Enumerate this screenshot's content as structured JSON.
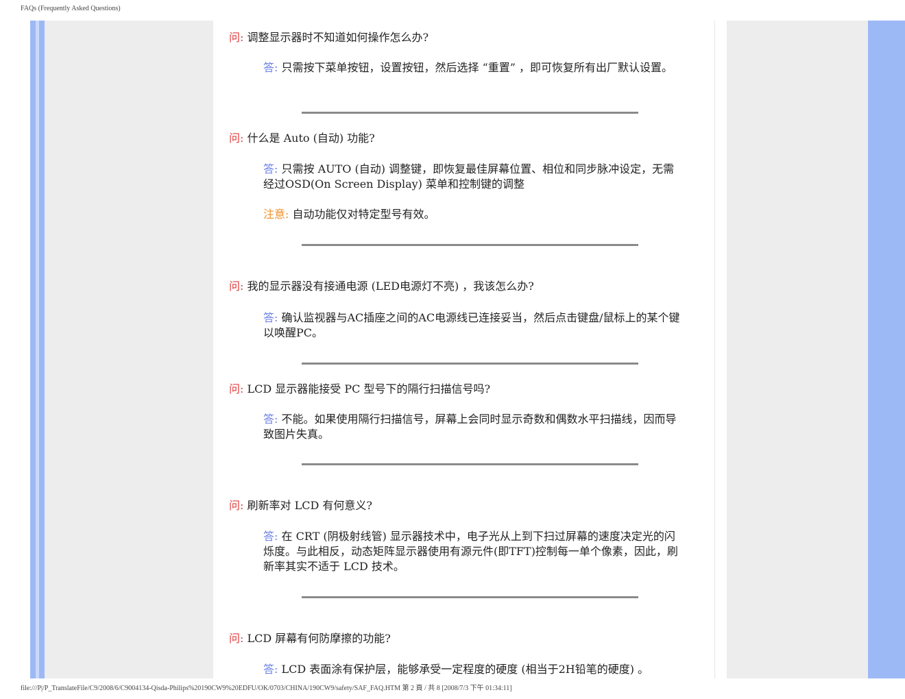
{
  "page": {
    "header_title": "FAQs (Frequently Asked Questions)",
    "footer_text": "file:///P|/P_TranslateFile/C9/2008/6/C9004134-Qisda-Philips%20190CW9%20EDFU/OK/0703/CHINA/190CW9/safety/SAF_FAQ.HTM 第 2 頁 / 共 8  [2008/7/3 下午 01:34:11]"
  },
  "labels": {
    "question": "问:",
    "answer": "答:",
    "note": "注意:"
  },
  "faqs": [
    {
      "question": "调整显示器时不知道如何操作怎么办?",
      "answer": "只需按下菜单按钮，设置按钮，然后选择 “重置” ，即可恢复所有出厂默认设置。"
    },
    {
      "question": "什么是 Auto (自动) 功能?",
      "answer": "只需按 AUTO (自动) 调整键，即恢复最佳屏幕位置、相位和同步脉冲设定，无需经过OSD(On Screen Display) 菜单和控制键的调整",
      "note": "自动功能仅对特定型号有效。"
    },
    {
      "question": "我的显示器没有接通电源 (LED电源灯不亮) ，我该怎么办?",
      "answer": "确认监视器与AC插座之间的AC电源线已连接妥当，然后点击键盘/鼠标上的某个键以唤醒PC。"
    },
    {
      "question": "LCD 显示器能接受 PC 型号下的隔行扫描信号吗?",
      "answer": "不能。如果使用隔行扫描信号，屏幕上会同时显示奇数和偶数水平扫描线，因而导致图片失真。"
    },
    {
      "question": "刷新率对 LCD 有何意义?",
      "answer": "在 CRT (阴极射线管) 显示器技术中，电子光从上到下扫过屏幕的速度决定光的闪烁度。与此相反，动态矩阵显示器使用有源元件(即TFT)控制每一单个像素，因此，刷新率其实不适于 LCD 技术。"
    },
    {
      "question": "LCD 屏幕有何防摩擦的功能?",
      "answer": "LCD 表面涂有保护层，能够承受一定程度的硬度 (相当于2H铅笔的硬度) 。"
    }
  ]
}
